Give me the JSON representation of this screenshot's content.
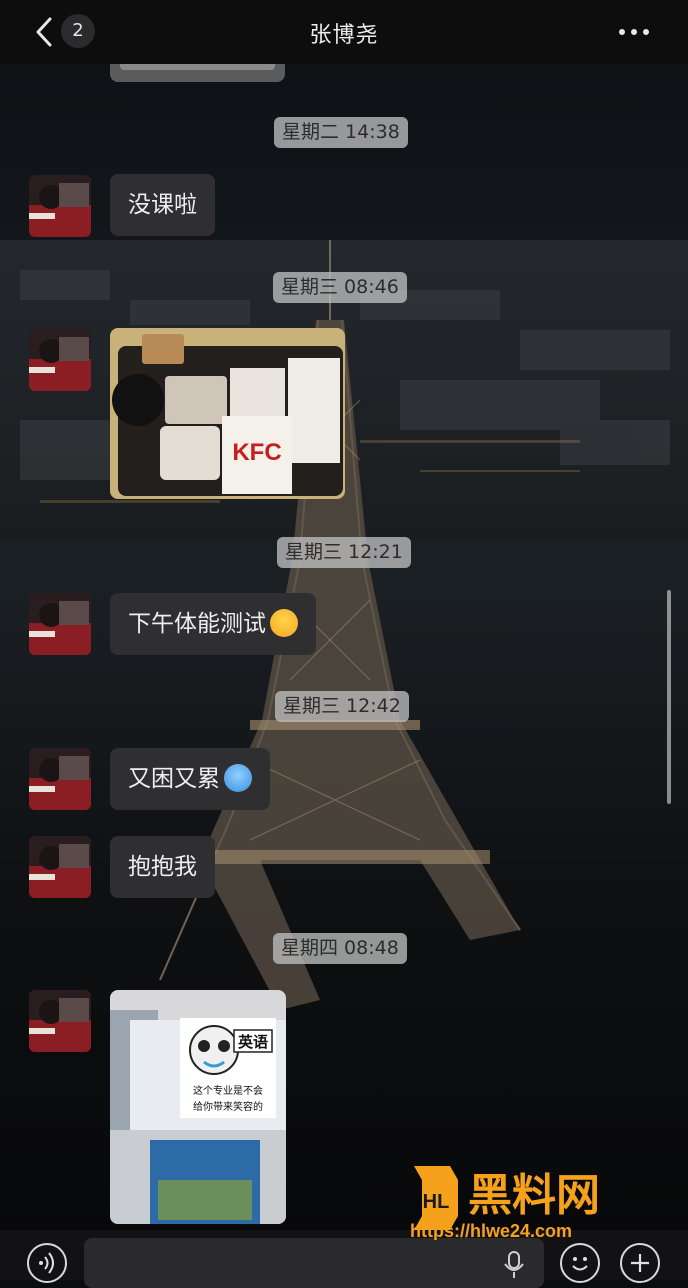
{
  "header": {
    "back_label": "back",
    "unread_count": "2",
    "title": "张博尧",
    "more_icon": "more-dots-icon"
  },
  "messages": [
    {
      "type": "timestamp",
      "text": "星期二 14:38"
    },
    {
      "type": "text",
      "text": "没课啦"
    },
    {
      "type": "timestamp",
      "text": "星期三 08:46"
    },
    {
      "type": "image",
      "desc_text": [
        "KFC"
      ]
    },
    {
      "type": "timestamp",
      "text": "星期三 12:21"
    },
    {
      "type": "text",
      "text": "下午体能测试",
      "emoji": "persevering-face-emoji"
    },
    {
      "type": "timestamp",
      "text": "星期三 12:42"
    },
    {
      "type": "text",
      "text": "又困又累",
      "emoji": "cold-face-emoji"
    },
    {
      "type": "text",
      "text": "抱抱我"
    },
    {
      "type": "timestamp",
      "text": "星期四 08:48"
    },
    {
      "type": "image",
      "meme_tag": "英语",
      "meme_caption_line1": "这个专业是不会",
      "meme_caption_line2": "给你带来笑容的"
    }
  ],
  "input_bar": {
    "voice_icon": "voice-mode-icon",
    "placeholder": "",
    "mic_icon": "microphone-icon",
    "emoji_icon": "emoji-icon",
    "plus_icon": "plus-icon"
  },
  "watermark": {
    "logo_text": "黑料网",
    "url": "https://hlwe24.com"
  },
  "colors": {
    "bubble": "#2f2f31",
    "timestamp_bg": "#bebebe",
    "watermark_orange": "#f5a11c"
  }
}
